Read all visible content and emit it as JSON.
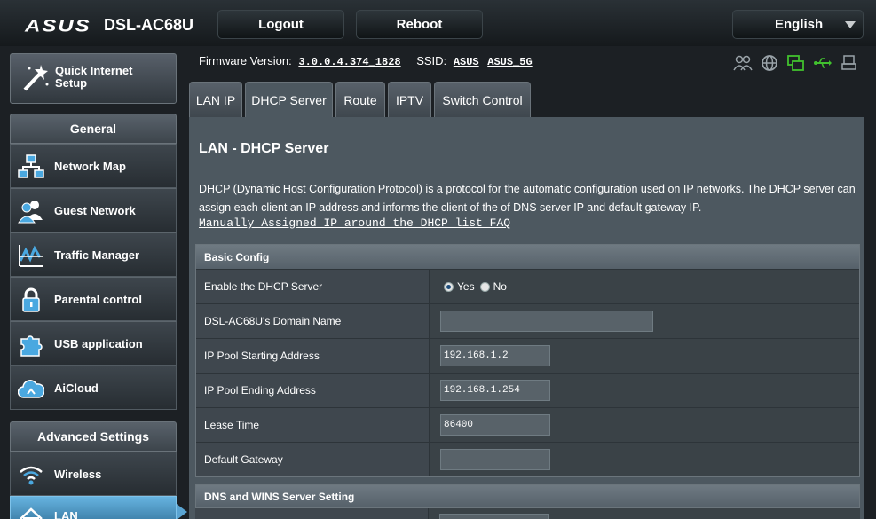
{
  "header": {
    "brand": "ASUS",
    "model": "DSL-AC68U",
    "logout_label": "Logout",
    "reboot_label": "Reboot",
    "language": "English"
  },
  "sidebar": {
    "quick_setup_label": "Quick Internet Setup",
    "general_title": "General",
    "general_items": [
      {
        "label": "Network Map",
        "icon": "network-map-icon"
      },
      {
        "label": "Guest Network",
        "icon": "guest-network-icon"
      },
      {
        "label": "Traffic Manager",
        "icon": "traffic-manager-icon"
      },
      {
        "label": "Parental control",
        "icon": "lock-icon"
      },
      {
        "label": "USB application",
        "icon": "puzzle-icon"
      },
      {
        "label": "AiCloud",
        "icon": "cloud-icon"
      }
    ],
    "advanced_title": "Advanced Settings",
    "advanced_items": [
      {
        "label": "Wireless",
        "icon": "wifi-icon"
      },
      {
        "label": "LAN",
        "icon": "home-icon",
        "active": true
      }
    ]
  },
  "status": {
    "firmware_label": "Firmware Version:",
    "firmware_value": "3.0.0.4.374_1828",
    "ssid_label": "SSID:",
    "ssid_1": "ASUS",
    "ssid_2": "ASUS_5G",
    "icons": [
      "clients-icon",
      "internet-globe-icon",
      "wan-link-icon",
      "usb-icon",
      "printer-icon"
    ],
    "active_color": "#41c12e"
  },
  "tabs": [
    {
      "label": "LAN IP",
      "active": false
    },
    {
      "label": "DHCP Server",
      "active": true
    },
    {
      "label": "Route",
      "active": false
    },
    {
      "label": "IPTV",
      "active": false
    },
    {
      "label": "Switch Control",
      "active": false
    }
  ],
  "main": {
    "title": "LAN - DHCP Server",
    "description": "DHCP (Dynamic Host Configuration Protocol) is a protocol for the automatic configuration used on IP networks. The DHCP server can assign each client an IP address and informs the client of the of DNS server IP and default gateway IP.",
    "faq_link": "Manually Assigned IP around the DHCP list FAQ",
    "basic_config": {
      "title": "Basic Config",
      "enable_label": "Enable the DHCP Server",
      "yes_label": "Yes",
      "no_label": "No",
      "enable_value": "Yes",
      "domain_label": "DSL-AC68U's Domain Name",
      "domain_value": "",
      "pool_start_label": "IP Pool Starting Address",
      "pool_start_value": "192.168.1.2",
      "pool_end_label": "IP Pool Ending Address",
      "pool_end_value": "192.168.1.254",
      "lease_label": "Lease Time",
      "lease_value": "86400",
      "gateway_label": "Default Gateway",
      "gateway_value": ""
    },
    "dns_section_title": "DNS and WINS Server Setting"
  }
}
